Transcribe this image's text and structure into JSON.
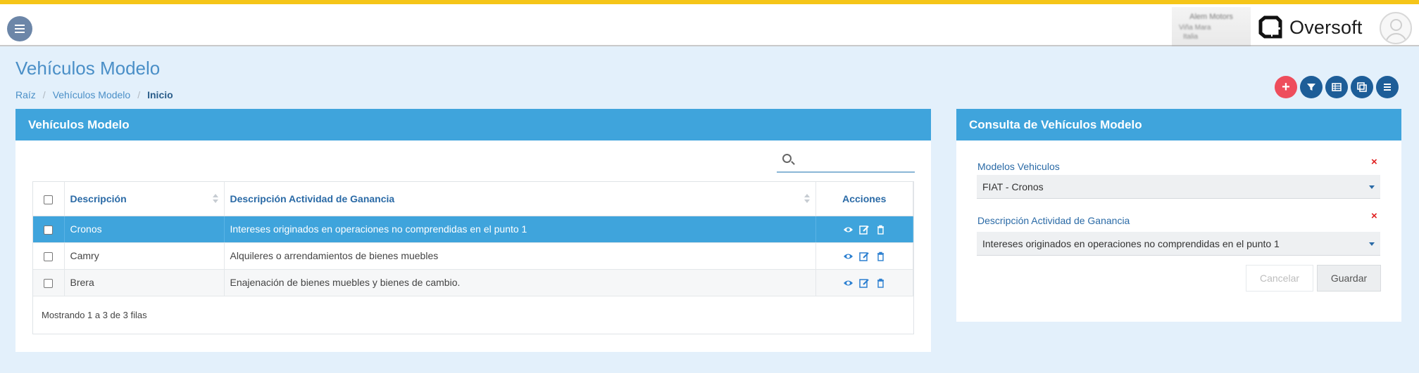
{
  "header": {
    "company": {
      "line1": "Alem Motors",
      "line2": "Viña Mara",
      "line3": "Italia"
    },
    "brand": "Oversoft"
  },
  "page": {
    "title": "Vehículos Modelo",
    "breadcrumb": [
      "Raíz",
      "Vehículos Modelo",
      "Inicio"
    ]
  },
  "toolbar": {
    "buttons": [
      "add-icon",
      "filter-icon",
      "grid-icon",
      "copy-icon",
      "list-icon"
    ]
  },
  "list_panel": {
    "title": "Vehículos Modelo",
    "search_value": "",
    "columns": [
      "Descripción",
      "Descripción Actividad de Ganancia",
      "Acciones"
    ],
    "rows": [
      {
        "descripcion": "Cronos",
        "actividad": "Intereses originados en operaciones no comprendidas en el punto 1",
        "selected": true
      },
      {
        "descripcion": "Camry",
        "actividad": "Alquileres o arrendamientos de bienes muebles",
        "selected": false
      },
      {
        "descripcion": "Brera",
        "actividad": "Enajenación de bienes muebles y bienes de cambio.",
        "selected": false
      }
    ],
    "footer": "Mostrando 1 a 3 de 3 filas"
  },
  "form_panel": {
    "title": "Consulta de Vehículos Modelo",
    "field1_label": "Modelos Vehiculos",
    "field1_value": "FIAT - Cronos",
    "field2_label": "Descripción Actividad de Ganancia",
    "field2_value": "Intereses originados en operaciones no comprendidas en el punto 1",
    "clear_symbol": "×",
    "cancel_label": "Cancelar",
    "save_label": "Guardar"
  },
  "colors": {
    "accent_bar": "#f5c518",
    "panel_header": "#3fa4dc",
    "selected_row": "#3fa4dc",
    "toolbar_button": "#1d5d98",
    "add_button": "#ee4d5c",
    "clear_x": "#e02020"
  }
}
